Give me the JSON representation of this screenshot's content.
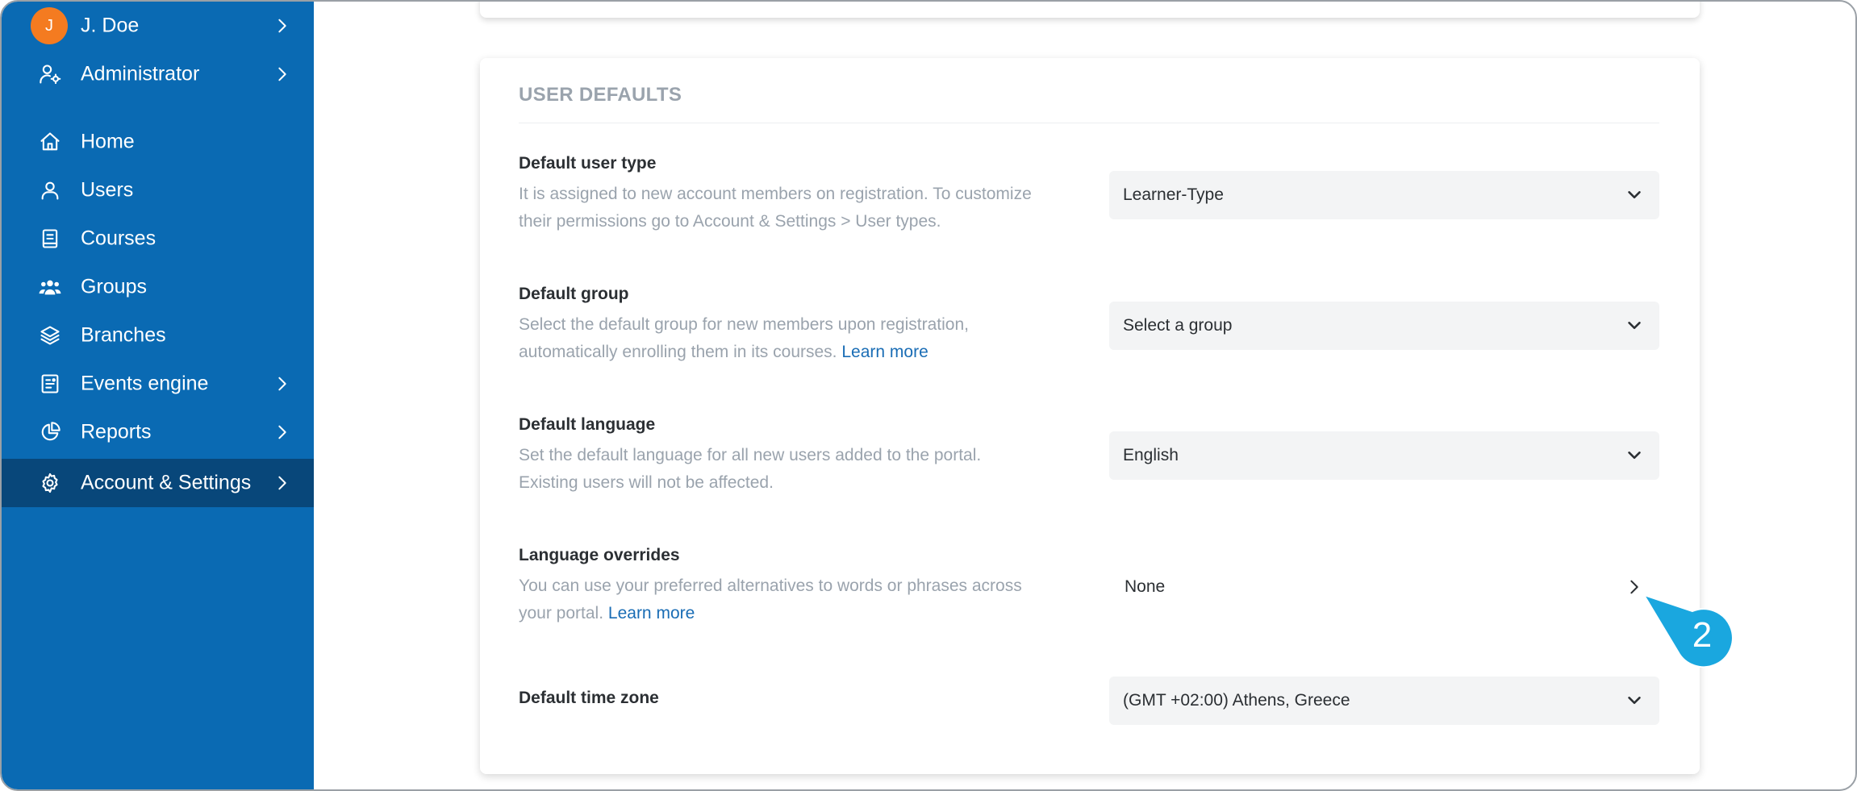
{
  "sidebar": {
    "user": {
      "initial": "J",
      "name": "J. Doe"
    },
    "role": {
      "label": "Administrator"
    },
    "items": [
      {
        "label": "Home",
        "icon": "home-icon"
      },
      {
        "label": "Users",
        "icon": "user-icon"
      },
      {
        "label": "Courses",
        "icon": "book-icon"
      },
      {
        "label": "Groups",
        "icon": "groups-icon"
      },
      {
        "label": "Branches",
        "icon": "layers-icon"
      },
      {
        "label": "Events engine",
        "icon": "events-icon"
      },
      {
        "label": "Reports",
        "icon": "pie-chart-icon"
      },
      {
        "label": "Account & Settings",
        "icon": "gear-icon",
        "active": true
      }
    ]
  },
  "section": {
    "title": "USER DEFAULTS",
    "fields": {
      "user_type": {
        "title": "Default user type",
        "desc_line1": "It is assigned to new account members on registration. To customize",
        "desc_line2": "their permissions go to Account & Settings > User types.",
        "value": "Learner-Type"
      },
      "group": {
        "title": "Default group",
        "desc_line1": "Select the default group for new members upon registration,",
        "desc_line2": "automatically enrolling them in its courses.",
        "link": "Learn more",
        "value": "Select a group"
      },
      "language": {
        "title": "Default language",
        "desc_line1": "Set the default language for all new users added to the portal.",
        "desc_line2": "Existing users will not be affected.",
        "value": "English"
      },
      "overrides": {
        "title": "Language overrides",
        "desc_line1": "You can use your preferred alternatives to words or phrases across",
        "desc_line2": "your portal.",
        "link": "Learn more",
        "value": "None"
      },
      "timezone": {
        "title": "Default time zone",
        "value": "(GMT +02:00) Athens, Greece"
      }
    }
  },
  "callout": {
    "label": "2"
  },
  "colors": {
    "sidebar": "#0a6ab3",
    "sidebar_active": "#08477a",
    "avatar": "#f47b20",
    "link": "#1a6db5",
    "callout": "#1aa7df"
  }
}
